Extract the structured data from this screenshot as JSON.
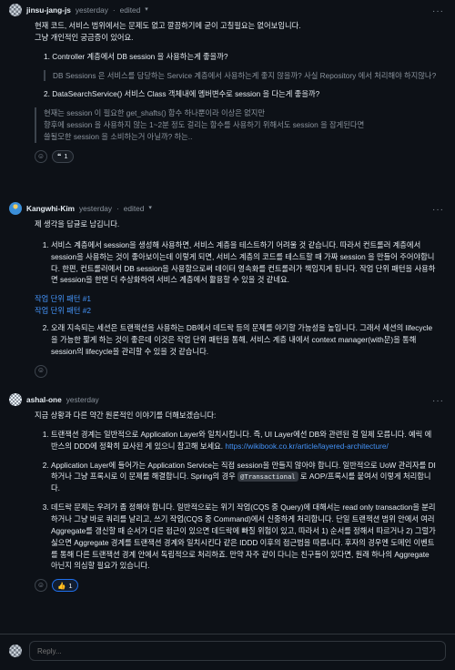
{
  "comments": [
    {
      "author": "jinsu-jang-js",
      "time": "yesterday",
      "edited": "edited",
      "intro": [
        "현재 코드, 서비스 범위에서는 문제도 없고 깔끔하기에 굳이 고칠필요는 없어보입니다.",
        "그냥 개인적인 궁금증이 있어요."
      ],
      "q1": "1. Controller 계층에서 DB session 을 사용하는게 좋을까?",
      "q1_quote": "DB Sessions 은 서비스를 담당하는 Service 계층에서 사용하는게 좋지 않을까? 사실 Repository 에서 처리해야 하지않나?",
      "q2": "2. DataSearchService() 서비스 Class 객체내에 멤버변수로 session 을 다는게 좋을까?",
      "q2_quote": [
        "현재는 session 이 필요한 get_shafts() 함수 하나뿐이라 이상은 없지만",
        "향후에 session 을 사용하지 않는 1~2분 정도 걸리는 함수를 사용하기 위해서도 session 을 잡게된다면",
        "쓸될모한 session 을 소비하는거 아닐까? 하는.."
      ],
      "reaction_count": "1"
    },
    {
      "author": "Kangwhi-Kim",
      "time": "yesterday",
      "edited": "edited",
      "intro": "제 생각을 답글로 남깁니다.",
      "item1": "서비스 계층에서 session을 생성해 사용하면, 서비스 계층을 테스트하기 어려울 것 같습니다. 따라서 컨트롤러 계층에서 session을 사용하는 것이 좋아보이는데 이렇게 되면, 서비스 계층의 코드를 테스트할 때 가짜 session 을 만들어 주어야합니다. 한편, 컨트롤러에서 DB session을 사용함으로써 데이터 영속화를 컨트롤러가 책임지게 됩니다. 작업 단위 패턴을 사용하면 session을 한번 더 추상화하여 서비스 계층에서 활용할 수 있을 것 같네요.",
      "link1": "작업 단위 패턴 #1",
      "link2": "작업 단위 패턴 #2",
      "item2": "오래 지속되는 세션은 트랜잭션을 사용하는 DB에서 데드락 등의 문제를 야기할 가능성을 높입니다. 그래서 세션의 lifecycle을 가능한 짧게 하는 것이 좋은데 이것은 작업 단위 패턴을 통해, 서비스 계층 내에서 context manager(with문)을 통해 session의 lifecycle을 관리할 수 있을 것 같습니다."
    },
    {
      "author": "ashal-one",
      "time": "yesterday",
      "intro": "지금 상황과 다른 약간 원론적인 이야기를 더해보겠습니다:",
      "item1_pre": "트랜잭션 경계는 일반적으로 Application Layer와 일치시킵니다. 즉, UI Layer에선 DB와 관련된 걸 일체 모릅니다. 예릭 에반스의 DDD에 정확히 묘사된 게 있으니 참고해 보세요. ",
      "item1_link": "https://wikibook.co.kr/article/layered-architecture/",
      "item2_pre": "Application Layer에 들어가는 Application Service는 직접 session을 만들지 않아야 합니다. 일반적으로 UoW 관리자를 DI하거나 그냥 프록시로 이 문제를 해결합니다. Spring의 경우 ",
      "item2_code": "@Transactional",
      "item2_post": " 로 AOP/프록시를 붙여서 이렇게 처리합니다.",
      "item3": "데드락 문제는 우려가 좀 정해야 합니다. 일반적으로는 위기 작업(CQS 중 Query)에 대해서는 read only transaction을 분리하거나 그냥 바로 쿼리를 날리고, 쓰기 작업(CQS 중 Command)에서 신중하게 처리합니다. 단일 트랜잭션 범위 안에서 여러 Aggregate를 갱신할 때 순서가 다른 접근이 있으면 데드락에 빠질 위험이 있고, 따라서 1) 순서를 정해서 따르거나 2) 그럴가 싫으면 Aggregate 경계를 트랜잭션 경계와 일치시킨다 같은 IDDD 이후의 접근법을 따릅니다. 후자의 경우엔 도메인 이벤트를 통해 다른 트랜잭션 경계 안에서 독립적으로 처리하죠. 만약 자주 같이 다니는 친구들이 있다면, 원래 하나의 Aggregate 아닌지 의심할 필요가 있습니다.",
      "reaction_count": "1"
    }
  ],
  "reply_placeholder": "Reply...",
  "icons": {
    "smiley": "smiley-icon",
    "quote": "quote-icon",
    "thumbs_up": "thumbs-up-icon",
    "kebab": "kebab-icon",
    "chevron": "chevron-down-icon"
  },
  "colors": {
    "link": "#4493f8",
    "background": "#0d1117",
    "text": "#e6edf3",
    "muted": "#8b949e"
  }
}
